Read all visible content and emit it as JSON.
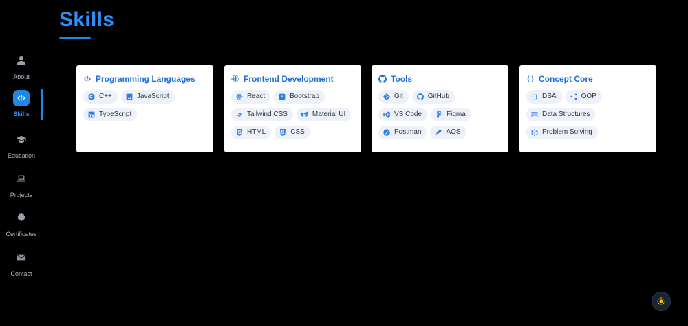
{
  "sidebar": {
    "items": [
      {
        "label": "About",
        "icon": "user-icon"
      },
      {
        "label": "Skills",
        "icon": "code-icon",
        "active": true
      },
      {
        "label": "Education",
        "icon": "graduation-cap-icon"
      },
      {
        "label": "Projects",
        "icon": "laptop-icon"
      },
      {
        "label": "Certificates",
        "icon": "badge-icon"
      },
      {
        "label": "Contact",
        "icon": "envelope-icon"
      }
    ]
  },
  "page": {
    "title": "Skills"
  },
  "cards": [
    {
      "title": "Programming Languages",
      "icon": "code-icon",
      "chips": [
        {
          "label": "C++",
          "icon": "cpp-icon"
        },
        {
          "label": "JavaScript",
          "icon": "javascript-icon"
        },
        {
          "label": "TypeScript",
          "icon": "typescript-icon"
        }
      ]
    },
    {
      "title": "Frontend Development",
      "icon": "react-icon",
      "chips": [
        {
          "label": "React",
          "icon": "react-icon"
        },
        {
          "label": "Bootstrap",
          "icon": "bootstrap-icon"
        },
        {
          "label": "Tailwind CSS",
          "icon": "tailwind-icon"
        },
        {
          "label": "Material UI",
          "icon": "material-ui-icon"
        },
        {
          "label": "HTML",
          "icon": "html-icon"
        },
        {
          "label": "CSS",
          "icon": "css-icon"
        }
      ]
    },
    {
      "title": "Tools",
      "icon": "github-icon",
      "chips": [
        {
          "label": "Git",
          "icon": "git-icon"
        },
        {
          "label": "GitHub",
          "icon": "github-icon"
        },
        {
          "label": "VS Code",
          "icon": "vscode-icon"
        },
        {
          "label": "Figma",
          "icon": "figma-icon"
        },
        {
          "label": "Postman",
          "icon": "postman-icon"
        },
        {
          "label": "AOS",
          "icon": "aos-icon"
        }
      ]
    },
    {
      "title": "Concept Core",
      "icon": "braces-icon",
      "chips": [
        {
          "label": "DSA",
          "icon": "braces-icon"
        },
        {
          "label": "OOP",
          "icon": "nodes-icon"
        },
        {
          "label": "Data Structures",
          "icon": "layers-icon"
        },
        {
          "label": "Problem Solving",
          "icon": "cube-icon"
        }
      ]
    }
  ],
  "theme_toggle": {
    "icon": "sun-icon"
  },
  "colors": {
    "accent": "#1e88e5",
    "title": "#2f8fff",
    "card_title": "#1e6fd9",
    "chip_bg": "#eef2f8",
    "background": "#000000",
    "toggle_sun": "#f5c518"
  }
}
